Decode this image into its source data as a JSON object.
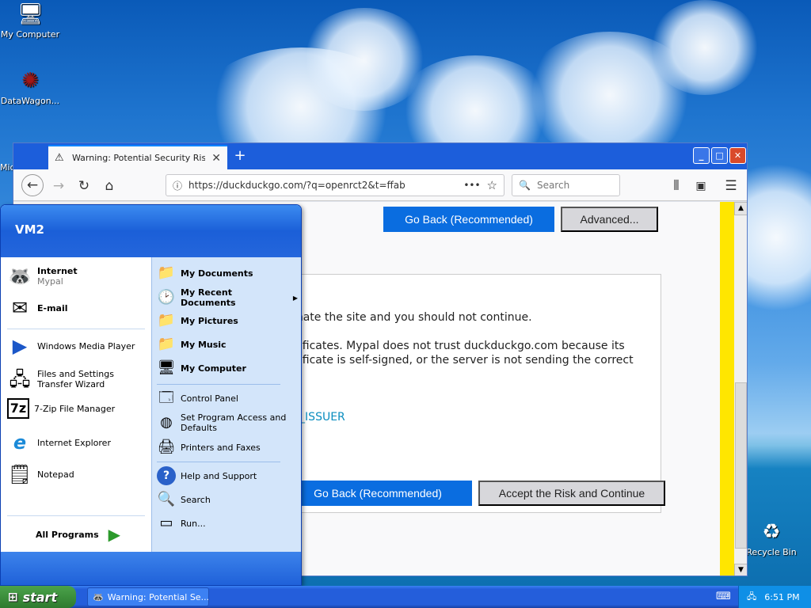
{
  "desktop": {
    "icons": [
      {
        "label": "My Computer",
        "icon": "my-computer-icon"
      },
      {
        "label": "DataWagon...",
        "icon": "datawagon-shortcut-icon"
      },
      {
        "label": "Mic",
        "icon": "microsoft-icon"
      },
      {
        "label": "Recycle Bin",
        "icon": "recycle-bin-icon"
      }
    ]
  },
  "browser": {
    "tab_title": "Warning: Potential Security Risk Ahead",
    "url": "https://duckduckgo.com/?q=openrct2&t=ffab",
    "search_placeholder": "Search",
    "page": {
      "go_back_top": "Go Back (Recommended)",
      "advanced": "Advanced...",
      "text_1": "sonate the site and you should not continue.",
      "text_2": "ertificates. Mypal does not trust duckduckgo.com because its",
      "text_3": "ertificate is self-signed, or the server is not sending the correct",
      "error_code": "VN_ISSUER",
      "go_back_bottom": "Go Back (Recommended)",
      "accept_risk": "Accept the Risk and Continue"
    }
  },
  "start_menu": {
    "user": "VM2",
    "pinned": [
      {
        "title": "Internet",
        "sub": "Mypal"
      },
      {
        "title": "E-mail",
        "sub": ""
      }
    ],
    "recent": [
      "Windows Media Player",
      "Files and Settings Transfer Wizard",
      "7-Zip File Manager",
      "Internet Explorer",
      "Notepad"
    ],
    "all_programs": "All Programs",
    "places": [
      "My Documents",
      "My Recent Documents",
      "My Pictures",
      "My Music",
      "My Computer"
    ],
    "settings": [
      "Control Panel",
      "Set Program Access and Defaults",
      "Printers and Faxes"
    ],
    "help": [
      "Help and Support",
      "Search",
      "Run..."
    ]
  },
  "taskbar": {
    "start": "start",
    "task_item": "Warning: Potential Se...",
    "clock": "6:51 PM"
  },
  "colors": {
    "xp_blue": "#245edb",
    "start_green": "#3c8f3c",
    "firefox_button": "#0a6de0",
    "yellow_bar": "#ffe600"
  }
}
